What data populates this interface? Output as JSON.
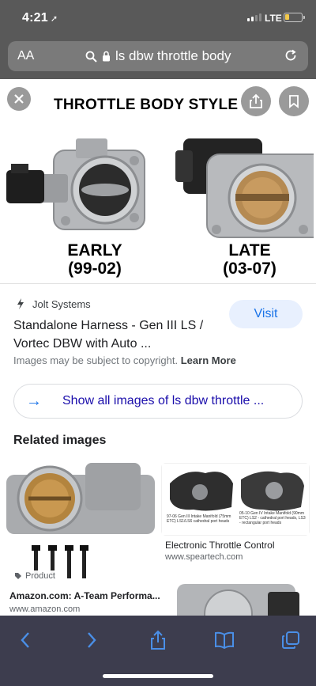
{
  "status": {
    "time": "4:21",
    "network": "LTE"
  },
  "browser": {
    "aa": "AA",
    "url": "ls dbw throttle body"
  },
  "hero": {
    "title": "THROTTLE BODY STYLE",
    "early_label": "EARLY",
    "early_years": "(99-02)",
    "late_label": "LATE",
    "late_years": "(03-07)"
  },
  "result": {
    "source": "Jolt Systems",
    "title": "Standalone Harness - Gen III LS / Vortec DBW with Auto ...",
    "visit_label": "Visit",
    "copyright": "Images may be subject to copyright.",
    "learn_more": "Learn More",
    "show_all": "Show all images of ls dbw throttle ..."
  },
  "related": {
    "heading": "Related images",
    "items": [
      {
        "badge": "Product",
        "title": "Amazon.com: A-Team Performa...",
        "source": "www.amazon.com"
      },
      {
        "title": "Electronic Throttle Control",
        "source": "www.speartech.com",
        "caption_left": "97-06 Gen III Intake Manifold (75mm ETC) LS1/LS6 cathedral port heads",
        "caption_right": "05-10 Gen IV Intake Manifold (90mm ETC) LS2 - cathedral port heads, LS3 - rectangular port heads"
      }
    ]
  },
  "icons": [
    "close-icon",
    "share-icon",
    "bookmark-icon",
    "back-icon",
    "forward-icon",
    "share-icon",
    "bookmarks-icon",
    "tabs-icon"
  ],
  "colors": {
    "accent": "#1a73e8",
    "link": "#1a0dab",
    "toolbar": "#3d3d4e",
    "chrome": "#595959"
  }
}
